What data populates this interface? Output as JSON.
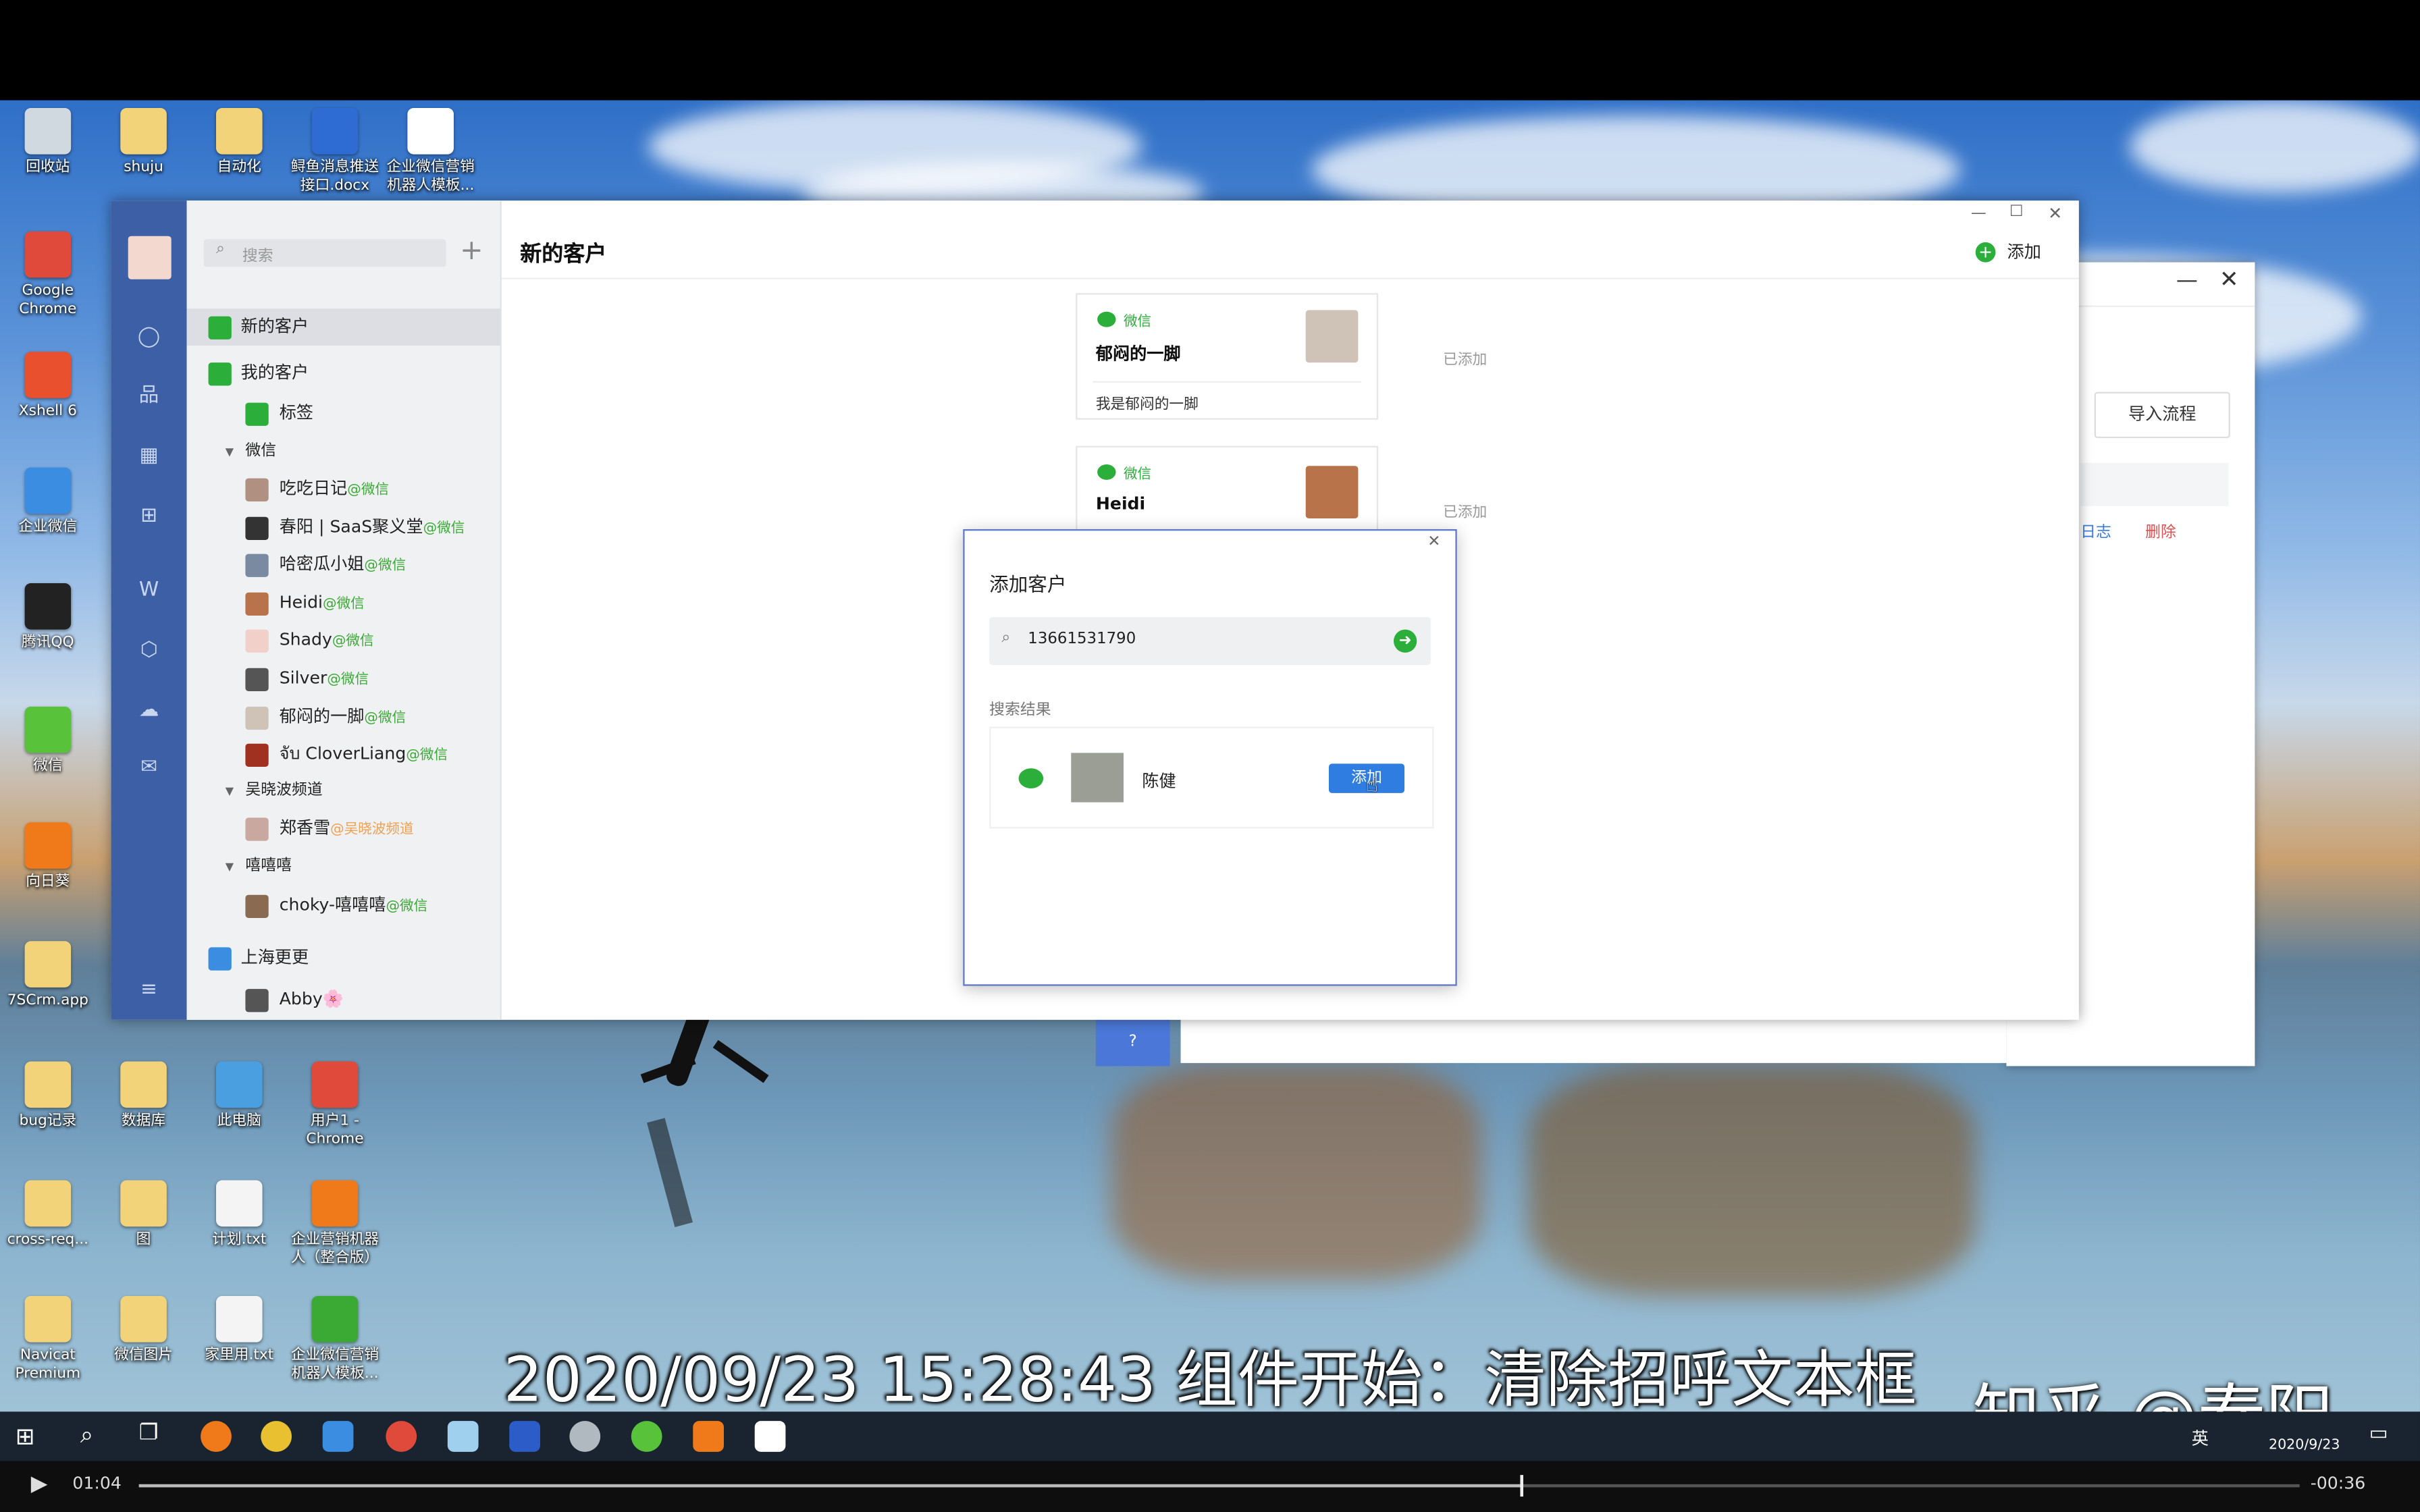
{
  "desktop": {
    "icons": [
      {
        "label": "回收站",
        "color": "#d0d8e0"
      },
      {
        "label": "shuju",
        "color": "#f3d37a"
      },
      {
        "label": "自动化",
        "color": "#f3d37a"
      },
      {
        "label": "鲟鱼消息推送\n接口.docx",
        "color": "#2e6bd3"
      },
      {
        "label": "企业微信营销\n机器人模板...",
        "color": "#ffffff"
      },
      {
        "label": "Google\nChrome",
        "color": "#e04a3a"
      },
      {
        "label": "Xshell 6",
        "color": "#e8502e"
      },
      {
        "label": "企业微信",
        "color": "#3a8de0"
      },
      {
        "label": "腾讯QQ",
        "color": "#222222"
      },
      {
        "label": "微信",
        "color": "#58c23a"
      },
      {
        "label": "向日葵",
        "color": "#f07a1a"
      },
      {
        "label": "7SCrm.app",
        "color": "#f3d37a"
      },
      {
        "label": "bug记录",
        "color": "#f3d37a"
      },
      {
        "label": "数据库",
        "color": "#f3d37a"
      },
      {
        "label": "此电脑",
        "color": "#4a9fe0"
      },
      {
        "label": "用户1 -\nChrome",
        "color": "#e04a3a"
      },
      {
        "label": "cross-req...",
        "color": "#f3d37a"
      },
      {
        "label": "图",
        "color": "#f3d37a"
      },
      {
        "label": "计划.txt",
        "color": "#f4f4f4"
      },
      {
        "label": "企业营销机器\n人（整合版）",
        "color": "#f07a1a"
      },
      {
        "label": "Navicat\nPremium",
        "color": "#f3d37a"
      },
      {
        "label": "微信图片",
        "color": "#f3d37a"
      },
      {
        "label": "家里用.txt",
        "color": "#f4f4f4"
      },
      {
        "label": "企业微信营销\n机器人模板...",
        "color": "#3aaa35"
      }
    ]
  },
  "window": {
    "search_placeholder": "搜索",
    "plus_label": "+",
    "title": "新的客户",
    "add_label": "添加",
    "nav": {
      "new_customers": "新的客户",
      "my_customers": "我的客户",
      "tags": "标签",
      "group_wechat": "微信",
      "group_wuxiaobo": "吴晓波频道",
      "group_xixixi": "嘻嘻嘻",
      "group_shanghai": "上海更更"
    },
    "contacts_wechat": [
      {
        "name": "吃吃日记",
        "tag": "@微信"
      },
      {
        "name": "春阳 | SaaS聚义堂",
        "tag": "@微信"
      },
      {
        "name": "哈密瓜小姐",
        "tag": "@微信"
      },
      {
        "name": "Heidi",
        "tag": "@微信"
      },
      {
        "name": "Shady",
        "tag": "@微信"
      },
      {
        "name": "Silver",
        "tag": "@微信"
      },
      {
        "name": "郁闷的一脚",
        "tag": "@微信"
      },
      {
        "name": "จับ CloverLiang",
        "tag": "@微信"
      }
    ],
    "contact_wuxiaobo": {
      "name": "郑香雪",
      "tag": "@吴晓波频道"
    },
    "contact_xixixi": {
      "name": "choky-嘻嘻嘻",
      "tag": "@微信"
    },
    "contact_shanghai": {
      "name": "Abby🌸"
    },
    "cards": [
      {
        "source": "微信",
        "name": "郁闷的一脚",
        "message": "我是郁闷的一脚",
        "status": "已添加"
      },
      {
        "source": "微信",
        "name": "Heidi",
        "message": "",
        "status": "已添加"
      }
    ]
  },
  "back_window": {
    "import_button": "导入流程",
    "log_link": "日志",
    "delete_link": "删除"
  },
  "dialog": {
    "title": "添加客户",
    "search_value": "13661531790",
    "results_label": "搜索结果",
    "result_name": "陈健",
    "add_button": "添加"
  },
  "taskbar": {
    "ime": "英",
    "date": "2020/9/23"
  },
  "player": {
    "elapsed": "01:04",
    "remaining": "-00:36",
    "progress": 0.64
  },
  "subtitle": "2020/09/23 15:28:43 组件开始：清除招呼文本框",
  "watermark": "知乎 @春阳",
  "colors": {
    "accent": "#3c5fa5",
    "wechat_green": "#2bae3a",
    "primary_button": "#2f7de1",
    "delete_red": "#e05050"
  }
}
